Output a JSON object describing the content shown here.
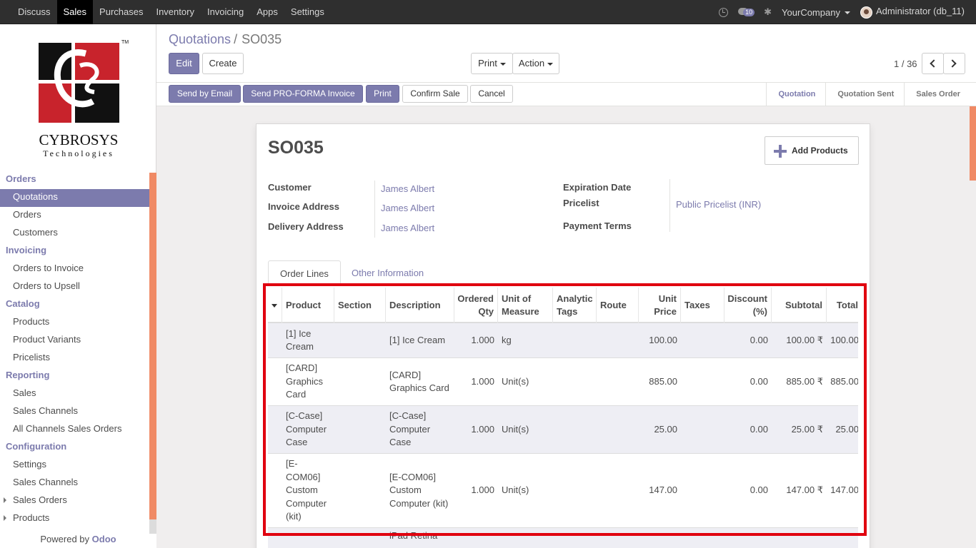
{
  "topbar": {
    "menu": [
      {
        "label": "Discuss",
        "active": false
      },
      {
        "label": "Sales",
        "active": true
      },
      {
        "label": "Purchases",
        "active": false
      },
      {
        "label": "Inventory",
        "active": false
      },
      {
        "label": "Invoicing",
        "active": false
      },
      {
        "label": "Apps",
        "active": false
      },
      {
        "label": "Settings",
        "active": false
      }
    ],
    "chat_badge": "10",
    "company": "YourCompany",
    "user": "Administrator (db_11)"
  },
  "logo": {
    "text_main": "CYBROSYS",
    "text_sub": "Technologies",
    "tm": "TM"
  },
  "sidebar": [
    {
      "type": "hdr",
      "label": "Orders"
    },
    {
      "type": "item",
      "label": "Quotations",
      "active": true
    },
    {
      "type": "item",
      "label": "Orders"
    },
    {
      "type": "item",
      "label": "Customers"
    },
    {
      "type": "hdr",
      "label": "Invoicing"
    },
    {
      "type": "item",
      "label": "Orders to Invoice"
    },
    {
      "type": "item",
      "label": "Orders to Upsell"
    },
    {
      "type": "hdr",
      "label": "Catalog"
    },
    {
      "type": "item",
      "label": "Products"
    },
    {
      "type": "item",
      "label": "Product Variants"
    },
    {
      "type": "item",
      "label": "Pricelists"
    },
    {
      "type": "hdr",
      "label": "Reporting"
    },
    {
      "type": "item",
      "label": "Sales"
    },
    {
      "type": "item",
      "label": "Sales Channels"
    },
    {
      "type": "item",
      "label": "All Channels Sales Orders"
    },
    {
      "type": "hdr",
      "label": "Configuration"
    },
    {
      "type": "item",
      "label": "Settings"
    },
    {
      "type": "item",
      "label": "Sales Channels"
    },
    {
      "type": "item",
      "label": "Sales Orders",
      "expandable": true
    },
    {
      "type": "item",
      "label": "Products",
      "expandable": true
    }
  ],
  "powered": {
    "prefix": "Powered by",
    "brand": "Odoo"
  },
  "breadcrumb": {
    "parent": "Quotations",
    "sep": "/",
    "current": "SO035"
  },
  "buttons": {
    "edit": "Edit",
    "create": "Create",
    "print": "Print",
    "action": "Action",
    "pager": "1 / 36",
    "send_email": "Send by Email",
    "send_proforma": "Send PRO-FORMA Invoice",
    "print2": "Print",
    "confirm": "Confirm Sale",
    "cancel": "Cancel"
  },
  "steps": [
    {
      "label": "Quotation",
      "current": true
    },
    {
      "label": "Quotation Sent",
      "current": false
    },
    {
      "label": "Sales Order",
      "current": false
    }
  ],
  "form": {
    "title": "SO035",
    "add_products": "Add Products",
    "customer_label": "Customer",
    "customer": "James Albert",
    "invoice_label": "Invoice Address",
    "invoice": "James Albert",
    "delivery_label": "Delivery Address",
    "delivery": "James Albert",
    "expiration_label": "Expiration Date",
    "pricelist_label": "Pricelist",
    "pricelist": "Public Pricelist (INR)",
    "payment_label": "Payment Terms",
    "tab_lines": "Order Lines",
    "tab_other": "Other Information"
  },
  "table": {
    "headers": [
      "Product",
      "Section",
      "Description",
      "Ordered Qty",
      "Unit of Measure",
      "Analytic Tags",
      "Route",
      "Unit Price",
      "Taxes",
      "Discount (%)",
      "Subtotal",
      "Total"
    ],
    "rows": [
      {
        "product": "[1] Ice Cream",
        "description": "[1] Ice Cream",
        "qty": "1.000",
        "uom": "kg",
        "price": "100.00",
        "discount": "0.00",
        "subtotal": "100.00 ₹",
        "total": "100.00"
      },
      {
        "product": "[CARD] Graphics Card",
        "description": "[CARD] Graphics Card",
        "qty": "1.000",
        "uom": "Unit(s)",
        "price": "885.00",
        "discount": "0.00",
        "subtotal": "885.00 ₹",
        "total": "885.00"
      },
      {
        "product": "[C-Case] Computer Case",
        "description": "[C-Case] Computer Case",
        "qty": "1.000",
        "uom": "Unit(s)",
        "price": "25.00",
        "discount": "0.00",
        "subtotal": "25.00 ₹",
        "total": "25.00"
      },
      {
        "product": "[E-COM06] Custom Computer (kit)",
        "description": "[E-COM06] Custom Computer (kit)",
        "qty": "1.000",
        "uom": "Unit(s)",
        "price": "147.00",
        "discount": "0.00",
        "subtotal": "147.00 ₹",
        "total": "147.00"
      },
      {
        "product": "",
        "description": "iPad Retina",
        "qty": "",
        "uom": "",
        "price": "",
        "discount": "",
        "subtotal": "",
        "total": ""
      }
    ]
  },
  "colors": {
    "accent": "#7c7bad",
    "highlight": "#e0000f",
    "scroll": "#f08a65"
  }
}
